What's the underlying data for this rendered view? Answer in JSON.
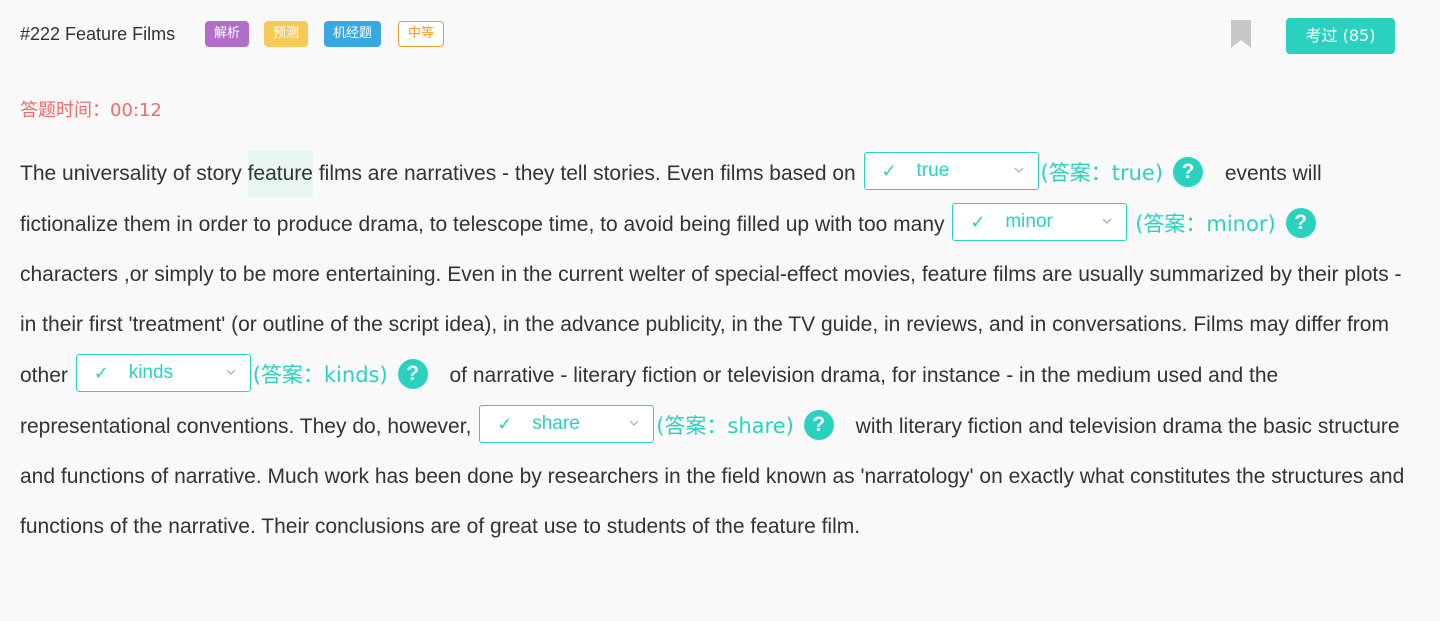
{
  "header": {
    "title": "#222 Feature Films",
    "tags": [
      "解析",
      "预测",
      "机经题",
      "中等"
    ],
    "bookmark_icon": "bookmark-icon",
    "exam_button": "考过 (85)"
  },
  "timer": {
    "label": "答题时间：",
    "value": "00:12"
  },
  "passage": {
    "s1": "The universality of story ",
    "highlight": "feature",
    "s2": " films are narratives - they tell stories. Even films based on ",
    "blank1": {
      "value": "true",
      "answer": "(答案：true)"
    },
    "s3": " events will fictionalize them in order to produce drama, to telescope time, to avoid being filled up with too many ",
    "blank2": {
      "value": "minor",
      "answer": "(答案：minor)"
    },
    "s4": " characters ,or simply to be more entertaining. Even in the current welter of special-effect movies, feature films are usually summarized by their plots - in their first 'treatment' (or outline of the script idea), in the advance publicity, in the TV guide, in reviews, and in conversations. Films may differ from other ",
    "blank3": {
      "value": "kinds",
      "answer": "(答案：kinds)"
    },
    "s5": " of narrative - literary fiction or television drama, for instance - in the medium used and the representational conventions. They do, however, ",
    "blank4": {
      "value": "share",
      "answer": "(答案：share)"
    },
    "s6": " with literary fiction and television drama the basic structure and functions of narrative. Much work has been done by researchers in the field known as 'narratology' on exactly what constitutes the structures and functions of the narrative. Their conclusions are of great use to students of the feature film.",
    "check_mark": "✓",
    "help_mark": "?"
  },
  "colors": {
    "accent": "#2bd1bf",
    "timer": "#ef6a6a",
    "tag_purple": "#b06ec8",
    "tag_yellow": "#f7c95a",
    "tag_blue": "#3aa8e0",
    "tag_outline": "#f0a030"
  }
}
